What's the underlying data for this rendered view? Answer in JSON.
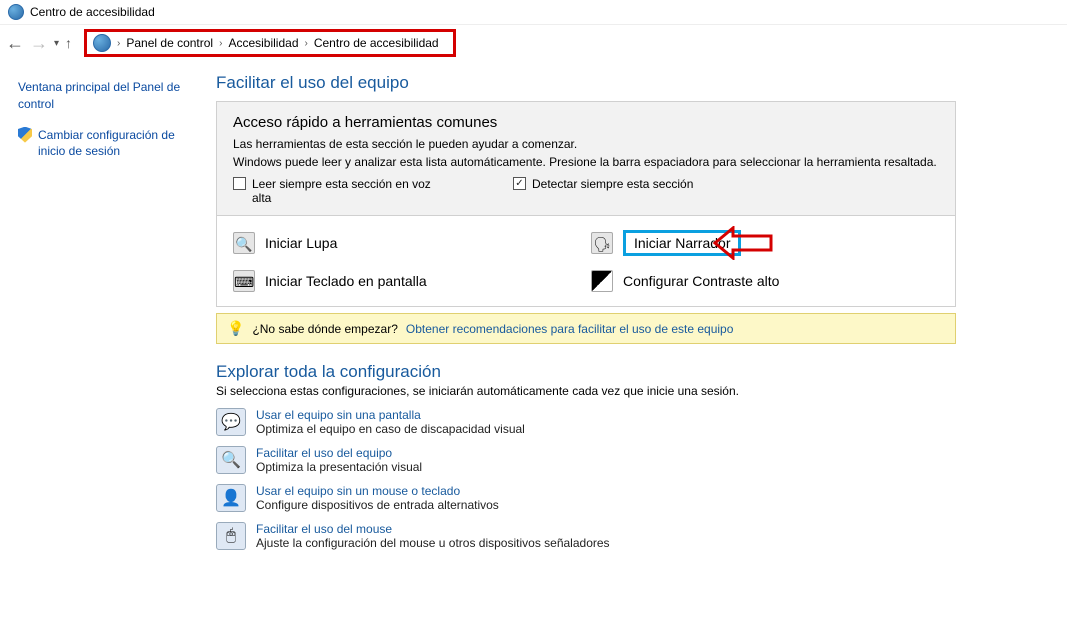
{
  "window": {
    "title": "Centro de accesibilidad"
  },
  "breadcrumb": {
    "items": [
      "Panel de control",
      "Accesibilidad",
      "Centro de accesibilidad"
    ]
  },
  "sidebar": {
    "link_main": "Ventana principal del Panel de control",
    "link_login": "Cambiar configuración de inicio de sesión"
  },
  "main": {
    "heading": "Facilitar el uso del equipo",
    "panel": {
      "title": "Acceso rápido a herramientas comunes",
      "desc1": "Las herramientas de esta sección le pueden ayudar a comenzar.",
      "desc2": "Windows puede leer y analizar esta lista automáticamente. Presione la barra espaciadora para seleccionar la herramienta resaltada.",
      "chk_read": "Leer siempre esta sección en voz alta",
      "chk_detect": "Detectar siempre esta sección"
    },
    "tools": {
      "lupa": "Iniciar Lupa",
      "narrador": "Iniciar Narrador",
      "teclado": "Iniciar Teclado en pantalla",
      "contraste": "Configurar Contraste alto"
    },
    "help": {
      "q": "¿No sabe dónde empezar?",
      "link": "Obtener recomendaciones para facilitar el uso de este equipo"
    },
    "explore": {
      "title": "Explorar toda la configuración",
      "sub": "Si selecciona estas configuraciones, se iniciarán automáticamente cada vez que inicie una sesión.",
      "items": [
        {
          "t": "Usar el equipo sin una pantalla",
          "d": "Optimiza el equipo en caso de discapacidad visual",
          "icon": "💬"
        },
        {
          "t": "Facilitar el uso del equipo",
          "d": "Optimiza la presentación visual",
          "icon": "🔍"
        },
        {
          "t": "Usar el equipo sin un mouse o teclado",
          "d": "Configure dispositivos de entrada alternativos",
          "icon": "👤"
        },
        {
          "t": "Facilitar el uso del mouse",
          "d": "Ajuste la configuración del mouse u otros dispositivos señaladores",
          "icon": "🖱"
        }
      ]
    }
  }
}
